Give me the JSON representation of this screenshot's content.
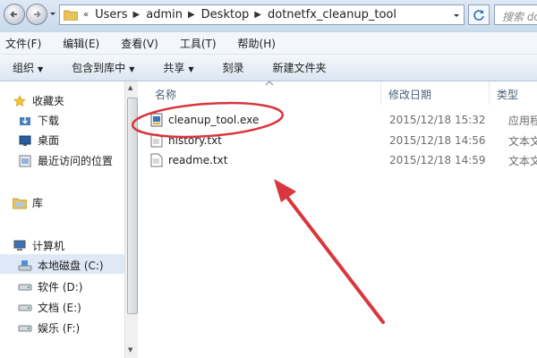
{
  "address_bar": {
    "crumbs": [
      "Users",
      "admin",
      "Desktop",
      "dotnetfx_cleanup_tool"
    ],
    "search_placeholder": "搜索 dotnet"
  },
  "menu": [
    "文件(F)",
    "编辑(E)",
    "查看(V)",
    "工具(T)",
    "帮助(H)"
  ],
  "toolbar": {
    "organize": "组织",
    "include_library": "包含到库中",
    "share": "共享",
    "burn": "刻录",
    "new_folder": "新建文件夹"
  },
  "nav": {
    "favorites": "收藏夹",
    "downloads": "下载",
    "desktop": "桌面",
    "recent": "最近访问的位置",
    "libraries": "库",
    "computer": "计算机",
    "drives": [
      "本地磁盘 (C:)",
      "软件 (D:)",
      "文档 (E:)",
      "娱乐 (F:)"
    ]
  },
  "columns": {
    "name": "名称",
    "modified": "修改日期",
    "type": "类型"
  },
  "files": [
    {
      "name": "cleanup_tool.exe",
      "modified": "2015/12/18 15:32",
      "type": "应用程序"
    },
    {
      "name": "history.txt",
      "modified": "2015/12/18 14:56",
      "type": "文本文档"
    },
    {
      "name": "readme.txt",
      "modified": "2015/12/18 14:59",
      "type": "文本文档"
    }
  ],
  "annotation_color": "#d9363e"
}
